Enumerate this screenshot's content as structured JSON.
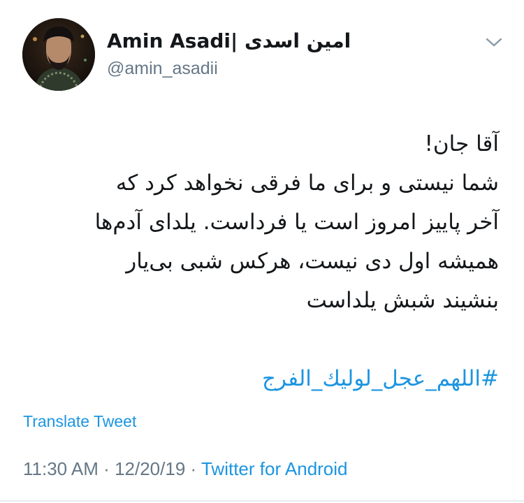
{
  "author": {
    "display_name": "Amin Asadi| امین اسدی",
    "handle": "@amin_asadii",
    "avatar_icon": "profile-photo"
  },
  "menu": {
    "icon": "chevron-down-icon"
  },
  "tweet": {
    "lines": [
      "آقا جان!",
      "شما نیستی و برای ما فرقی نخواهد کرد که",
      "آخر پاییز امروز است یا فرداست. یلدای آدم‌ها",
      "همیشه اول دی نیست، هرکس شبی بی‌یار",
      "بنشیند شبش یلداست"
    ],
    "hashtag": "#اللهم_عجل_لولیك_الفرج"
  },
  "translate_label": "Translate Tweet",
  "meta": {
    "time": "11:30 AM",
    "separator": "·",
    "date": "12/20/19",
    "source": "Twitter for Android"
  },
  "colors": {
    "link": "#1b95e0",
    "secondary_text": "#657786",
    "primary_text": "#14171a",
    "divider": "#e6ecf0"
  }
}
